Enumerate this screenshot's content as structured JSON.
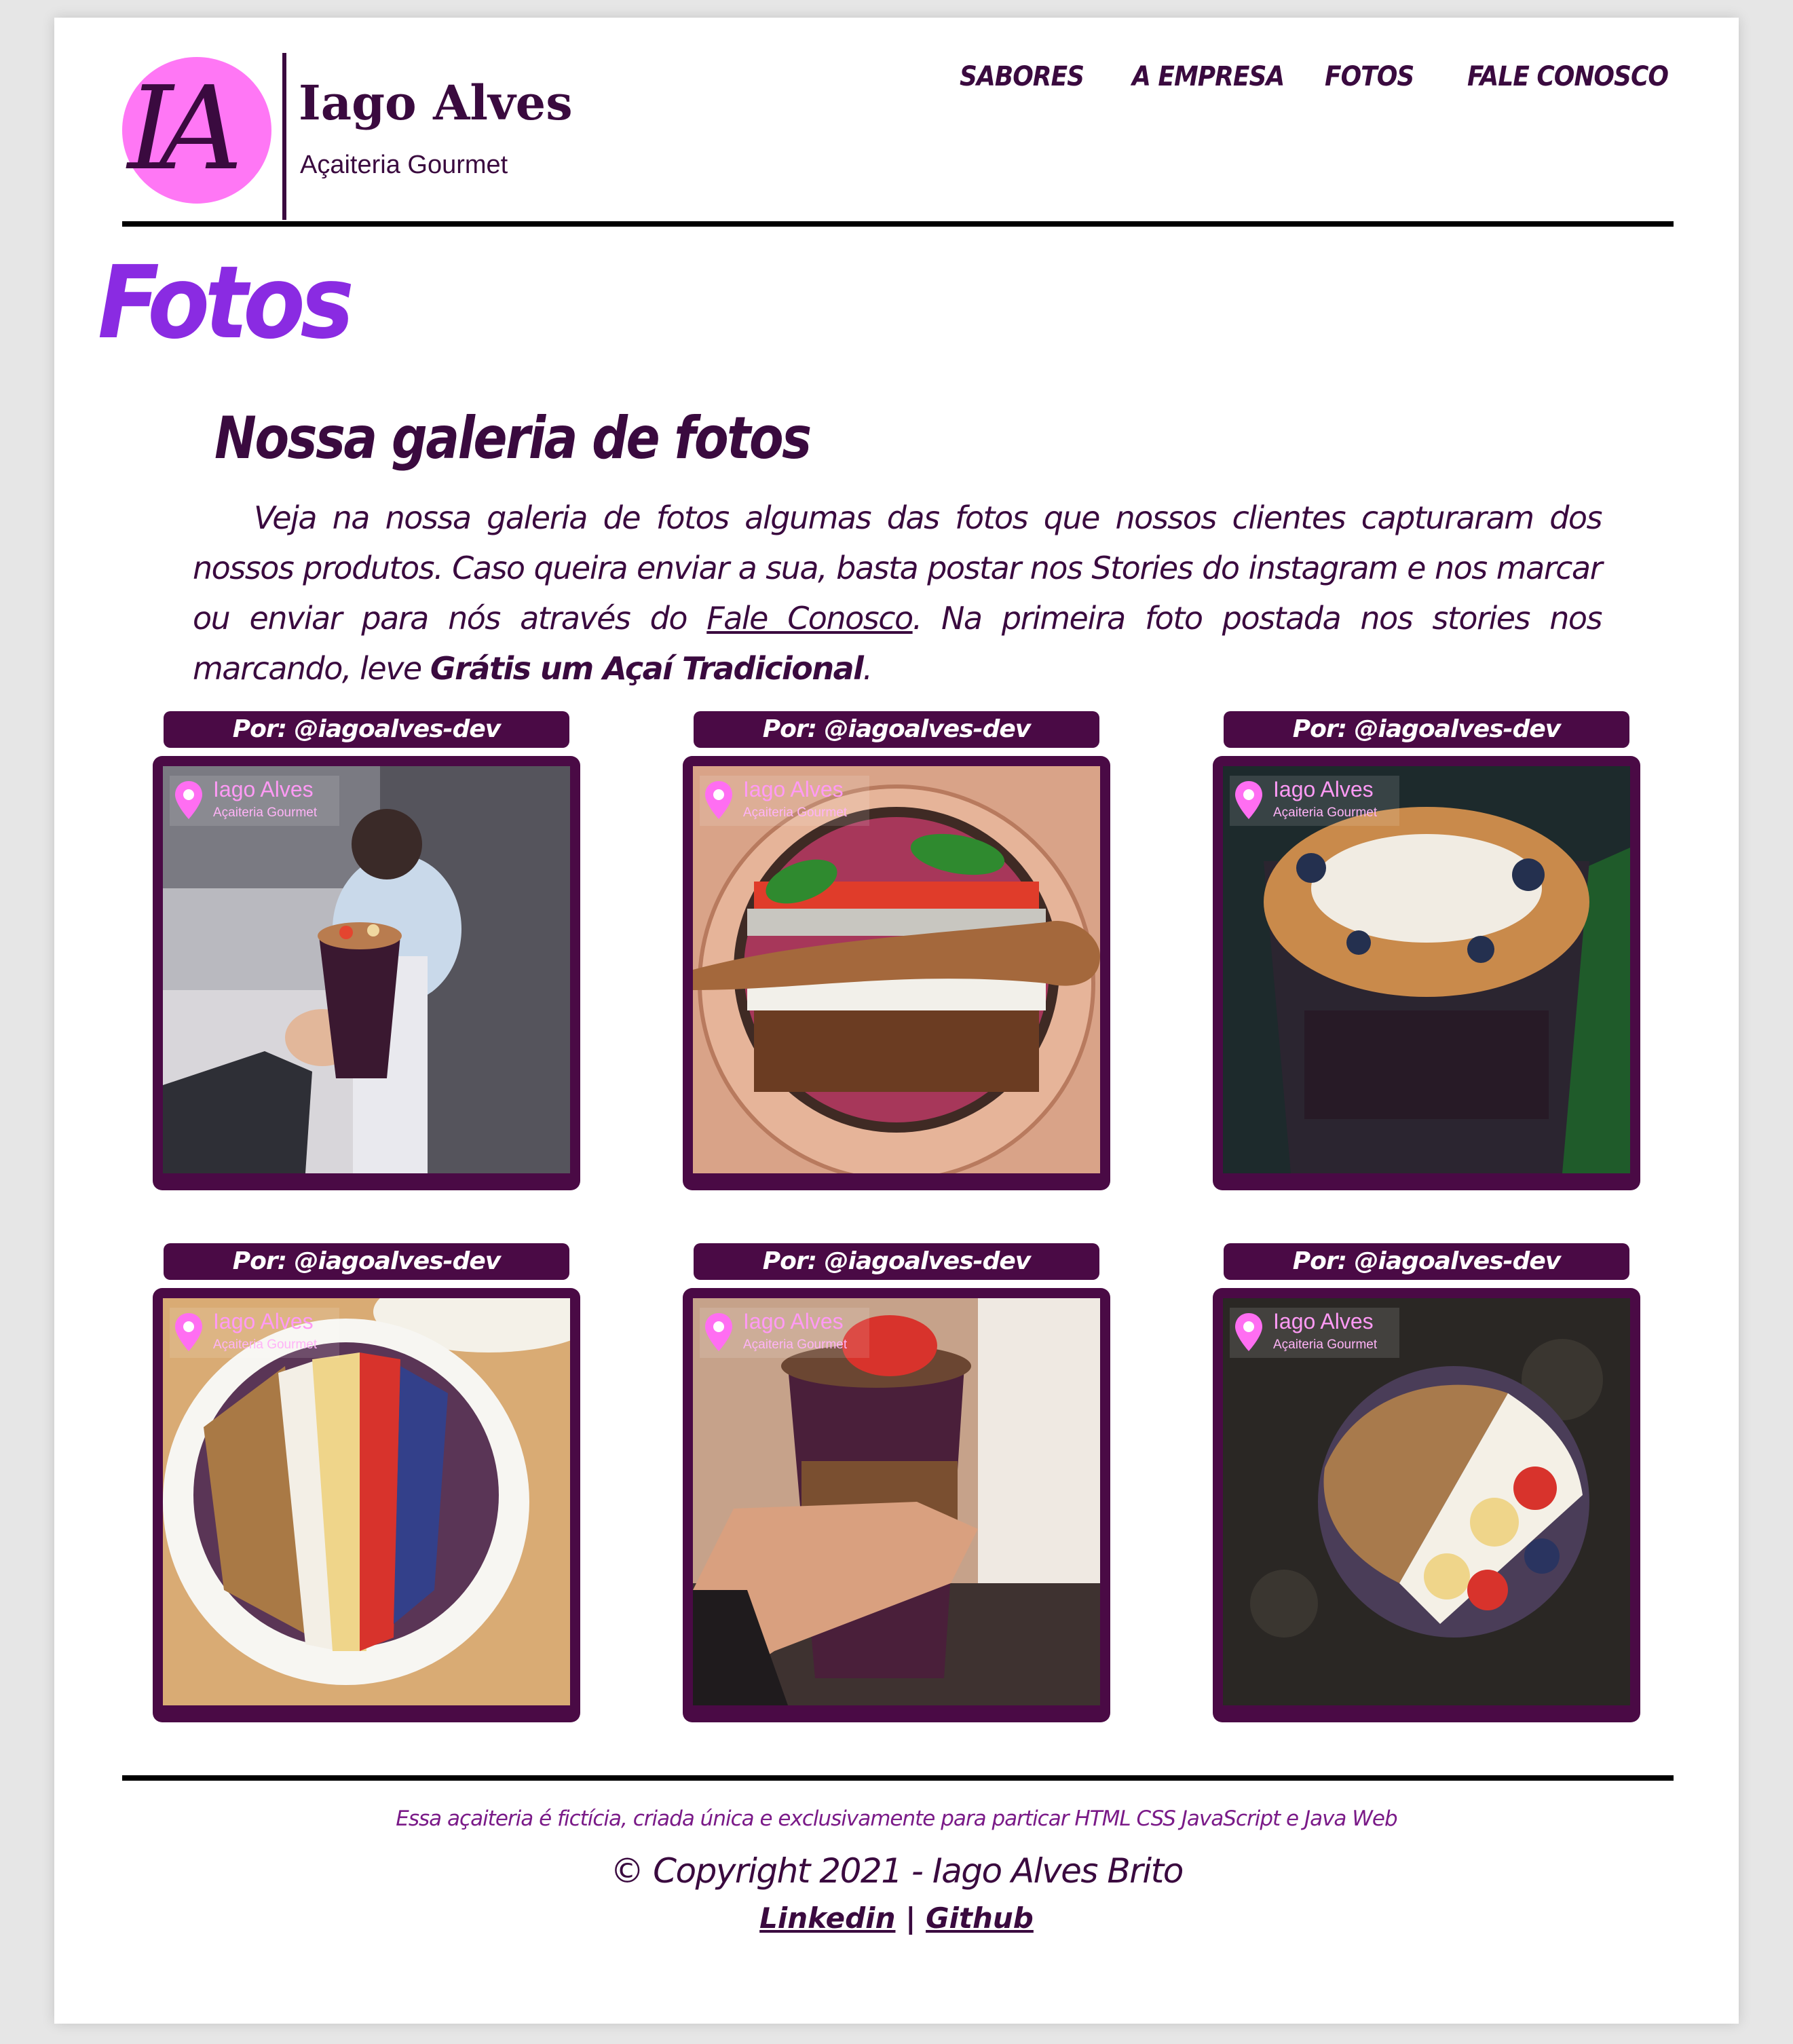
{
  "brand": {
    "monogram": "IA",
    "name": "Iago Alves",
    "tagline": "Açaiteria Gourmet"
  },
  "nav": {
    "items": [
      "SABORES",
      "A EMPRESA",
      "FOTOS",
      "FALE CONOSCO"
    ]
  },
  "page": {
    "title": "Fotos",
    "subtitle": "Nossa galeria de fotos",
    "intro_before_link": "Veja na nossa galeria de fotos algumas das fotos que nossos clientes capturaram dos nossos produtos. Caso queira enviar a sua, basta postar nos Stories do instagram e nos marcar ou enviar para nós através do ",
    "intro_link": "Fale Conosco",
    "intro_after_link": ". Na primeira foto postada nos stories nos marcando, leve ",
    "intro_bold": "Grátis um Açaí Tradicional",
    "intro_end": "."
  },
  "gallery": {
    "items": [
      {
        "credit": "Por: @iagoalves-dev",
        "photo_icon": "acai-cup-in-hand-street"
      },
      {
        "credit": "Por: @iagoalves-dev",
        "photo_icon": "acai-bowl-wooden-spoon"
      },
      {
        "credit": "Por: @iagoalves-dev",
        "photo_icon": "acai-cup-coconut-blueberry"
      },
      {
        "credit": "Por: @iagoalves-dev",
        "photo_icon": "acai-bowl-banana-strawberry"
      },
      {
        "credit": "Por: @iagoalves-dev",
        "photo_icon": "acai-cup-strawberry-hand"
      },
      {
        "credit": "Por: @iagoalves-dev",
        "photo_icon": "acai-bowl-dark-granola"
      }
    ],
    "watermark_name": "Iago Alves",
    "watermark_sub": "Açaiteria Gourmet"
  },
  "footer": {
    "note": "Essa açaiteria é fictícia, criada única e exclusivamente para particar HTML CSS JavaScript e Java Web",
    "copyright": "© Copyright 2021 - Iago Alves Brito",
    "linkedin": "Linkedin",
    "separator": "|",
    "github": "Github"
  },
  "colors": {
    "accent_purple": "#8a2be2",
    "brand_dark": "#3a0a3f",
    "frame": "#4a0a45",
    "logo_pink": "#ff77f5"
  }
}
